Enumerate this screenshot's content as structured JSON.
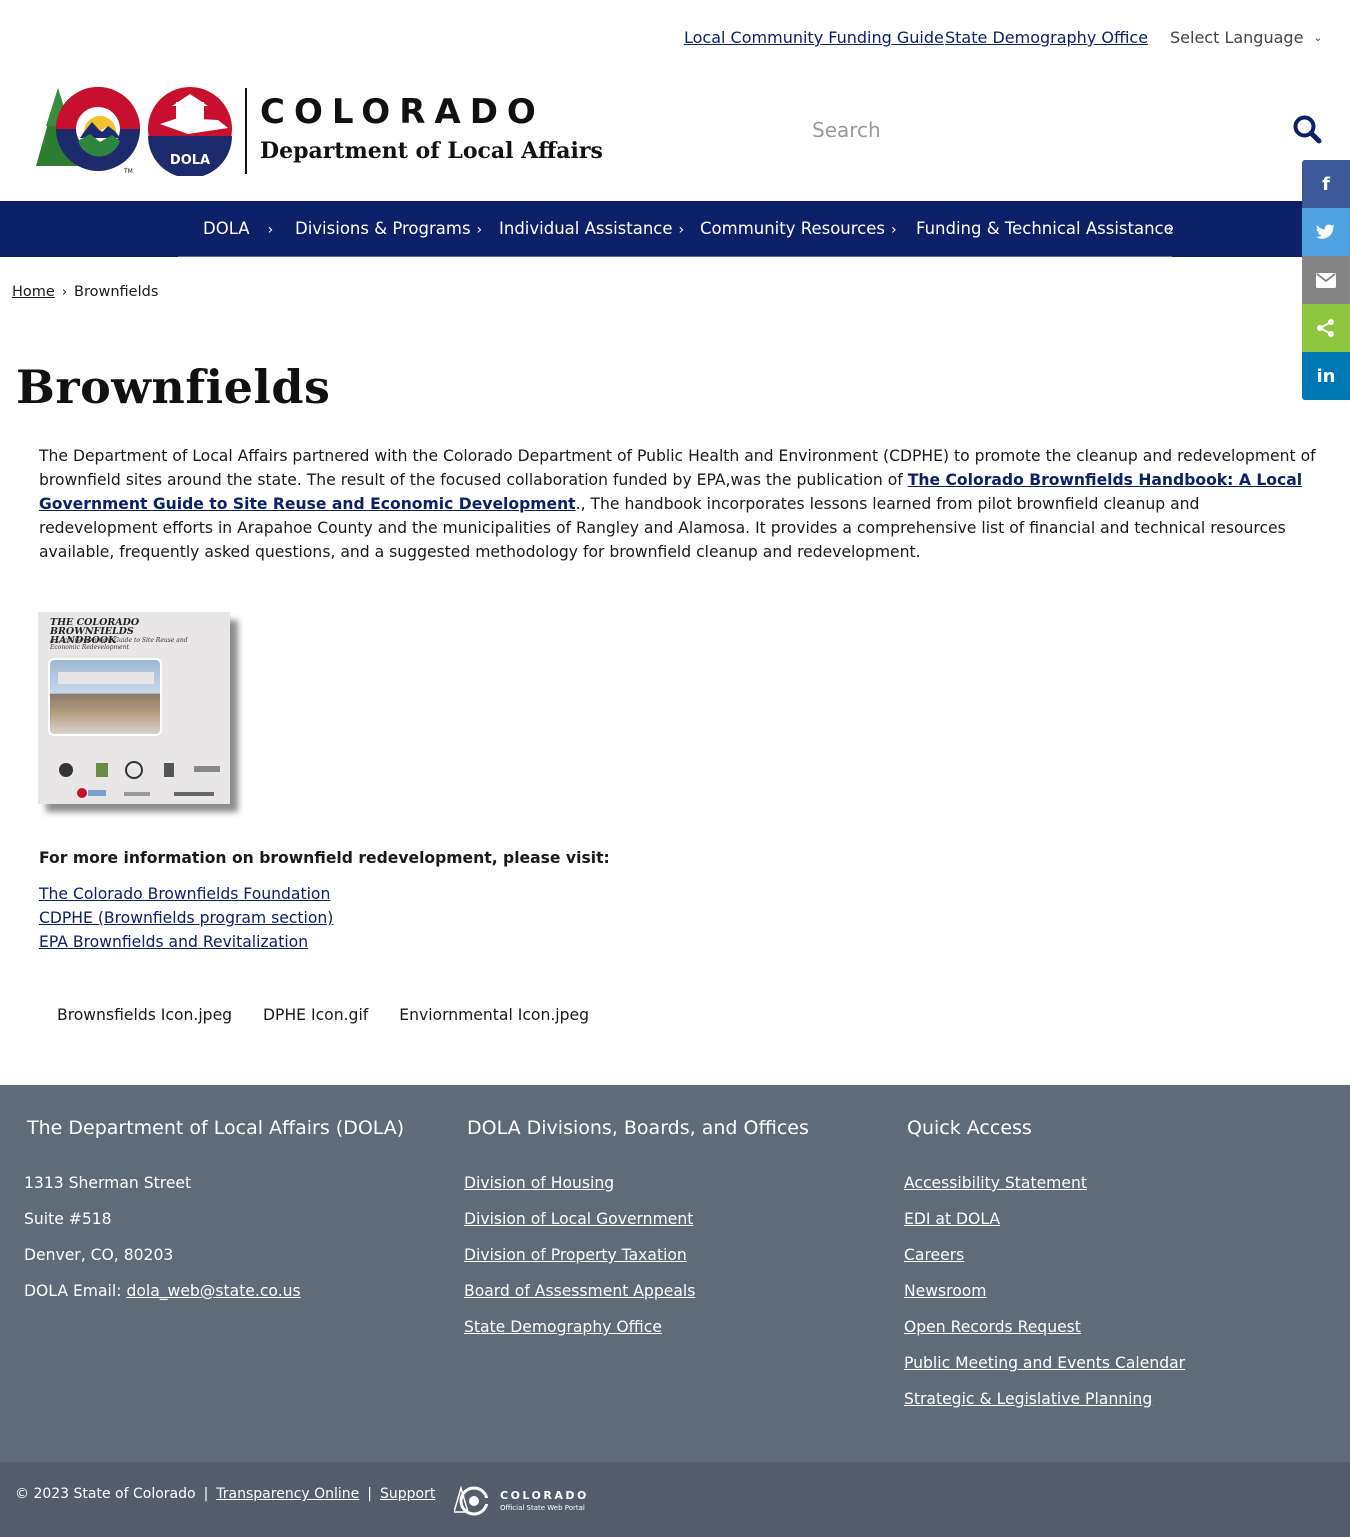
{
  "utility": {
    "links": [
      "Local Community Funding Guide",
      "State Demography Office"
    ],
    "language_label": "Select Language"
  },
  "brand": {
    "title": "COLORADO",
    "subtitle": "Department of Local Affairs",
    "badge": "DOLA",
    "tm": "TM"
  },
  "search": {
    "placeholder": "Search"
  },
  "nav": {
    "items": [
      "DOLA",
      "Divisions & Programs",
      "Individual Assistance",
      "Community Resources",
      "Funding & Technical Assistance"
    ]
  },
  "share": {
    "facebook": "f",
    "linkedin": "in"
  },
  "breadcrumb": {
    "home": "Home",
    "current": "Brownfields"
  },
  "page": {
    "title": "Brownfields",
    "intro_before": "The Department of Local Affairs partnered with the Colorado Department of Public Health and Environment (CDPHE) to promote the cleanup and redevelopment of brownfield sites around the state. The result of the focused collaboration funded by EPA,was the publication of ",
    "intro_link": "The Colorado Brownfields Handbook: A Local Government Guide to Site Reuse and Economic Development",
    "intro_after": "., The handbook incorporates lessons learned from pilot brownfield cleanup and redevelopment efforts in Arapahoe County and the municipalities of Rangley and Alamosa. It provides a comprehensive list of financial and technical resources available, frequently asked questions, and a suggested methodology for brownfield cleanup and redevelopment.",
    "cover_title": "THE COLORADO BROWNFIELDS HANDBOOK",
    "cover_subtitle": "A Local Government Guide to Site Reuse and Economic Redevelopment",
    "more_info": "For more information on brownfield redevelopment, please visit:",
    "resources": [
      "The Colorado Brownfields Foundation",
      "CDPHE (Brownfields program section)",
      "EPA Brownfields and Revitalization"
    ],
    "icon_alts": [
      "Brownsfields Icon.jpeg",
      "DPHE Icon.gif",
      "Enviornmental Icon.jpeg"
    ]
  },
  "footer": {
    "col1": {
      "heading": "The Department of Local Affairs (DOLA)",
      "address": [
        "1313 Sherman Street",
        "Suite  #518",
        "Denver, CO, 80203"
      ],
      "email_label": "DOLA Email: ",
      "email": "dola_web@state.co.us"
    },
    "col2": {
      "heading": "DOLA Divisions, Boards, and Offices",
      "links": [
        "Division of Housing",
        "Division of Local Government",
        "Division of Property Taxation",
        "Board of Assessment Appeals",
        "State Demography Office"
      ]
    },
    "col3": {
      "heading": "Quick Access",
      "links": [
        "Accessibility Statement",
        "EDI at DOLA",
        "Careers",
        "Newsroom",
        "Open Records Request",
        "Public Meeting and Events Calendar",
        "Strategic & Legislative Planning"
      ]
    }
  },
  "bottom": {
    "copyright": "© 2023 State of Colorado",
    "links": [
      "Transparency Online",
      "Support"
    ],
    "portal_title": "COLORADO",
    "portal_subtitle": "Official State Web Portal"
  },
  "colors": {
    "navy": "#0d2169",
    "footer": "#5f6b77",
    "bottom_bar": "#545d69",
    "facebook": "#3b5998",
    "twitter": "#4fa3e0",
    "email": "#848484",
    "share": "#8dc63f",
    "linkedin": "#0077b5"
  }
}
